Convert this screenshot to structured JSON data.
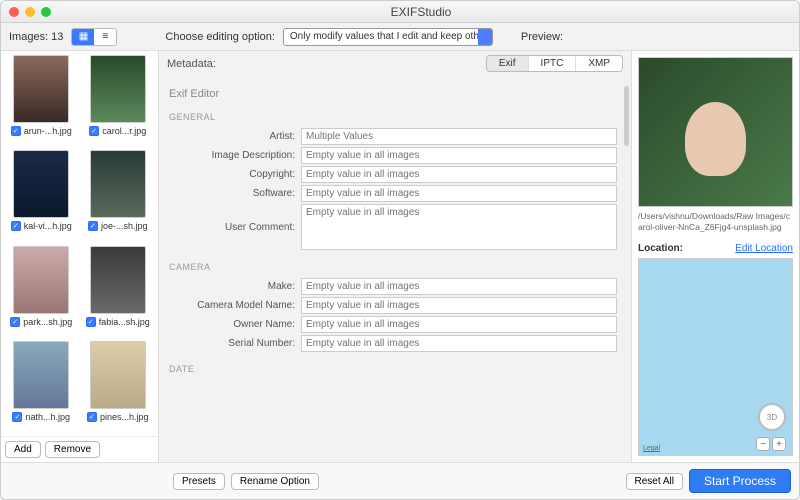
{
  "app": {
    "title": "EXIFStudio"
  },
  "sidebar": {
    "count_label": "Images:  13",
    "add": "Add",
    "remove": "Remove",
    "thumbs": [
      {
        "name": "arun-...h.jpg"
      },
      {
        "name": "carol...r.jpg"
      },
      {
        "name": "kal-vi...h.jpg"
      },
      {
        "name": "joe-...sh.jpg"
      },
      {
        "name": "park...sh.jpg"
      },
      {
        "name": "fabia...sh.jpg"
      },
      {
        "name": "nath...h.jpg"
      },
      {
        "name": "pines...h.jpg"
      }
    ]
  },
  "toolbar": {
    "choose_label": "Choose editing option:",
    "choose_value": "Only modify values that I edit and keep othe...",
    "preview_label": "Preview:"
  },
  "tabs": {
    "meta": "Metadata:",
    "exif": "Exif",
    "iptc": "IPTC",
    "xmp": "XMP"
  },
  "editor": {
    "title": "Exif Editor",
    "general": "GENERAL",
    "camera": "CAMERA",
    "date": "DATE",
    "fields": {
      "artist": {
        "label": "Artist:",
        "ph": "Multiple Values"
      },
      "imgdesc": {
        "label": "Image Description:",
        "ph": "Empty value in all images"
      },
      "copyright": {
        "label": "Copyright:",
        "ph": "Empty value in all images"
      },
      "software": {
        "label": "Software:",
        "ph": "Empty value in all images"
      },
      "usercomment": {
        "label": "User Comment:",
        "ph": "Empty value in all images"
      },
      "make": {
        "label": "Make:",
        "ph": "Empty value in all images"
      },
      "model": {
        "label": "Camera Model Name:",
        "ph": "Empty value in all images"
      },
      "owner": {
        "label": "Owner Name:",
        "ph": "Empty value in all images"
      },
      "serial": {
        "label": "Serial Number:",
        "ph": "Empty value in all images"
      }
    }
  },
  "bottom": {
    "presets": "Presets",
    "rename": "Rename Option",
    "reset": "Reset All",
    "start": "Start Process"
  },
  "preview": {
    "path": "/Users/vishnu/Downloads/Raw Images/carol-oliver-NnCa_Z6Fjg4-unsplash.jpg",
    "location": "Location:",
    "edit_location": "Edit Location",
    "legal": "Legal",
    "compass": "3D"
  }
}
